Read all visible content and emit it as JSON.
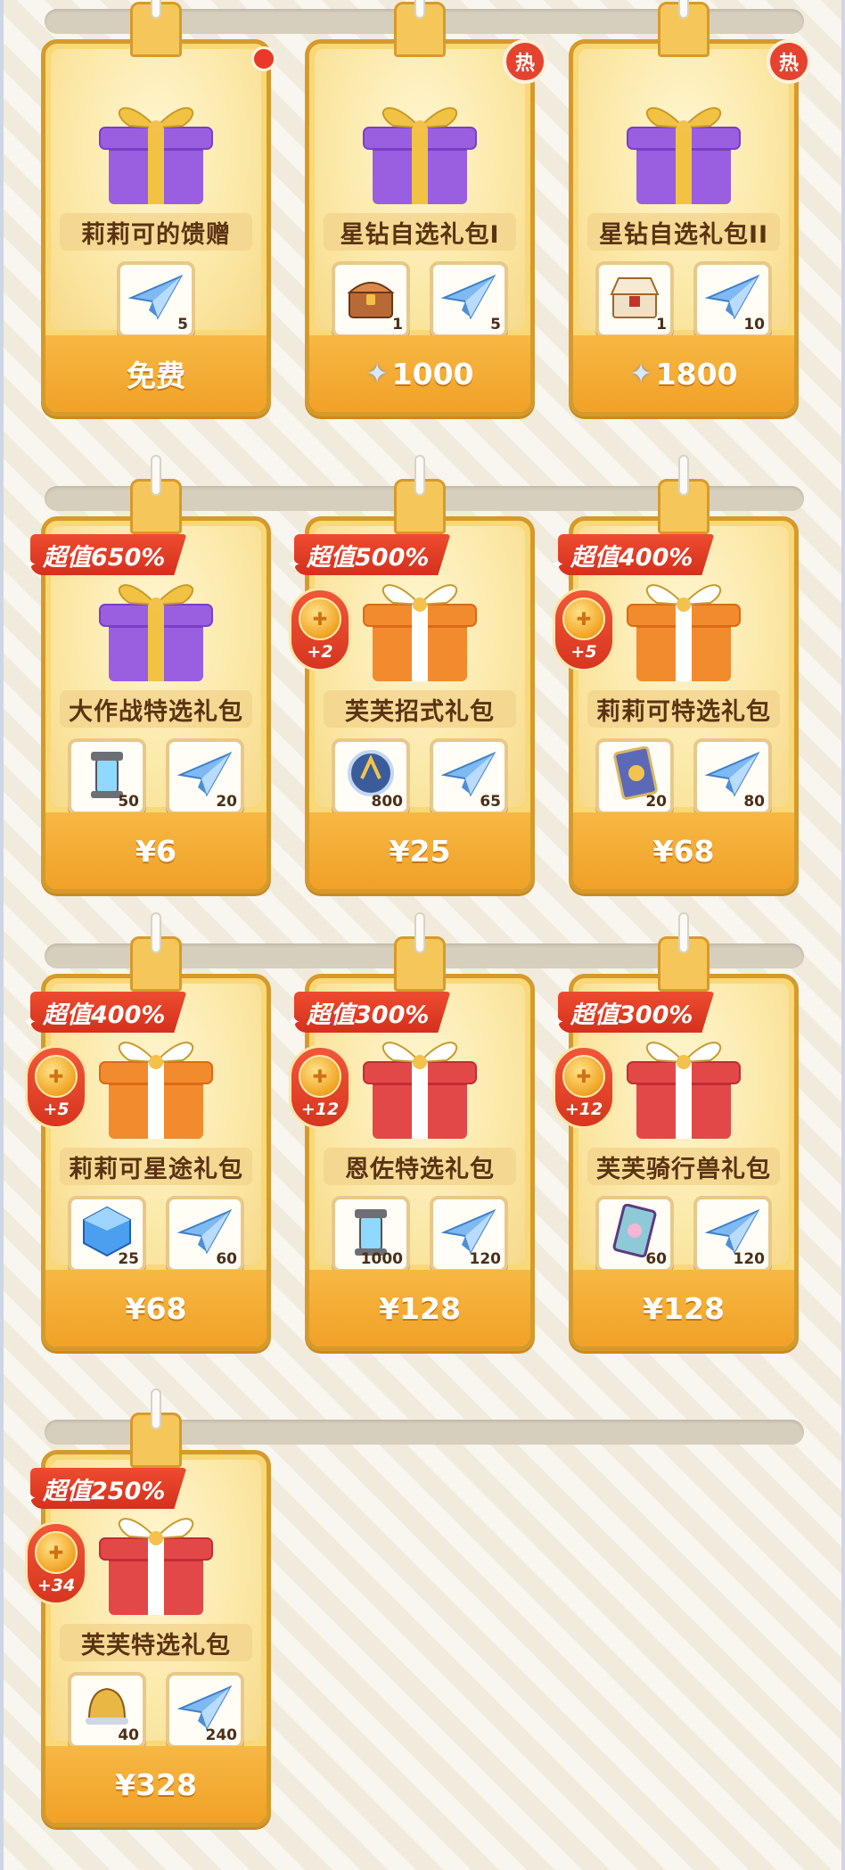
{
  "colors": {
    "accent": "#f1a127",
    "ribbon": "#d4301d",
    "hot_badge": "#e5432f",
    "card_border": "#d59a2b"
  },
  "rows": [
    {
      "cards": [
        {
          "name": "莉莉可的馈赠",
          "badge": "dot",
          "gift": "purple",
          "items": [
            {
              "icon": "paper-plane-icon",
              "qty": "5"
            }
          ],
          "price": "免费"
        },
        {
          "name": "星钻自选礼包I",
          "badge": "热",
          "gift": "purple",
          "items": [
            {
              "icon": "treasure-chest-icon",
              "qty": "1"
            },
            {
              "icon": "paper-plane-icon",
              "qty": "5"
            }
          ],
          "price": "1000",
          "price_icon": "star-diamond-icon"
        },
        {
          "name": "星钻自选礼包II",
          "badge": "热",
          "gift": "purple",
          "items": [
            {
              "icon": "ornate-chest-icon",
              "qty": "1"
            },
            {
              "icon": "paper-plane-icon",
              "qty": "10"
            }
          ],
          "price": "1800",
          "price_icon": "star-diamond-icon"
        }
      ]
    },
    {
      "cards": [
        {
          "name": "大作战特选礼包",
          "ribbon": "超值650%",
          "gift": "purple",
          "items": [
            {
              "icon": "energy-canister-icon",
              "qty": "50"
            },
            {
              "icon": "paper-plane-icon",
              "qty": "20"
            }
          ],
          "price": "¥6"
        },
        {
          "name": "芙芙招式礼包",
          "ribbon": "超值500%",
          "bonus": "+2",
          "gift": "orange",
          "items": [
            {
              "icon": "crystal-orb-icon",
              "qty": "800"
            },
            {
              "icon": "paper-plane-icon",
              "qty": "65"
            }
          ],
          "price": "¥25"
        },
        {
          "name": "莉莉可特选礼包",
          "ribbon": "超值400%",
          "bonus": "+5",
          "gift": "orange",
          "items": [
            {
              "icon": "skill-card-icon",
              "qty": "20"
            },
            {
              "icon": "paper-plane-icon",
              "qty": "80"
            }
          ],
          "price": "¥68"
        }
      ]
    },
    {
      "cards": [
        {
          "name": "莉莉可星途礼包",
          "ribbon": "超值400%",
          "bonus": "+5",
          "gift": "orange",
          "items": [
            {
              "icon": "blue-cube-icon",
              "qty": "25"
            },
            {
              "icon": "paper-plane-icon",
              "qty": "60"
            }
          ],
          "price": "¥68"
        },
        {
          "name": "恩佐特选礼包",
          "ribbon": "超值300%",
          "bonus": "+12",
          "gift": "red",
          "items": [
            {
              "icon": "energy-canister-icon",
              "qty": "1000"
            },
            {
              "icon": "paper-plane-icon",
              "qty": "120"
            }
          ],
          "price": "¥128"
        },
        {
          "name": "芙芙骑行兽礼包",
          "ribbon": "超值300%",
          "bonus": "+12",
          "gift": "red",
          "items": [
            {
              "icon": "mount-card-icon",
              "qty": "60"
            },
            {
              "icon": "paper-plane-icon",
              "qty": "120"
            }
          ],
          "price": "¥128"
        }
      ]
    },
    {
      "cards": [
        {
          "name": "芙芙特选礼包",
          "ribbon": "超值250%",
          "bonus": "+34",
          "gift": "red",
          "items": [
            {
              "icon": "golden-bell-icon",
              "qty": "40"
            },
            {
              "icon": "paper-plane-icon",
              "qty": "240"
            }
          ],
          "price": "¥328"
        }
      ]
    }
  ]
}
